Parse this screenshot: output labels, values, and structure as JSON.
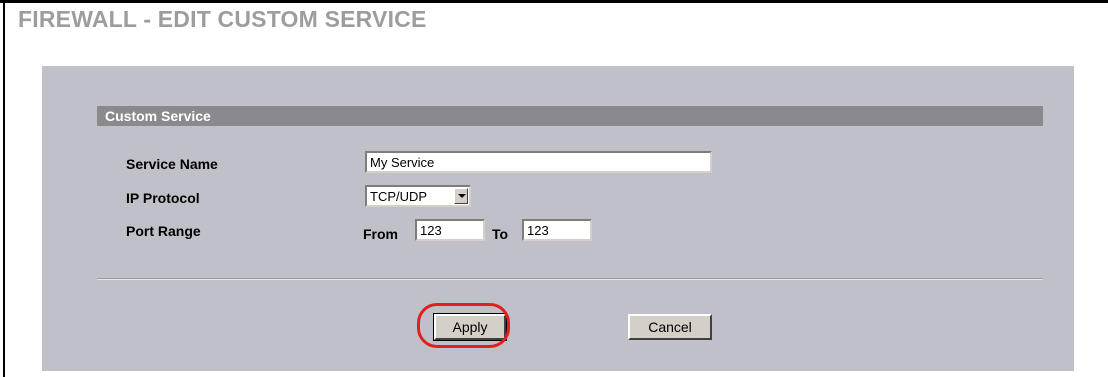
{
  "page": {
    "title": "FIREWALL - EDIT CUSTOM SERVICE"
  },
  "section": {
    "title": "Custom Service"
  },
  "form": {
    "service_name": {
      "label": "Service Name",
      "value": "My Service"
    },
    "ip_protocol": {
      "label": "IP Protocol",
      "selected": "TCP/UDP"
    },
    "port_range": {
      "label": "Port Range",
      "from_label": "From",
      "from_value": "123",
      "to_label": "To",
      "to_value": "123"
    }
  },
  "actions": {
    "apply_label": "Apply",
    "cancel_label": "Cancel"
  },
  "colors": {
    "highlight": "#e02020",
    "panel": "#c0c0c8",
    "section_bar": "#8a8a8e",
    "title": "#9d9d9d"
  },
  "icons": {
    "select_arrow": "chevron-down-icon"
  }
}
